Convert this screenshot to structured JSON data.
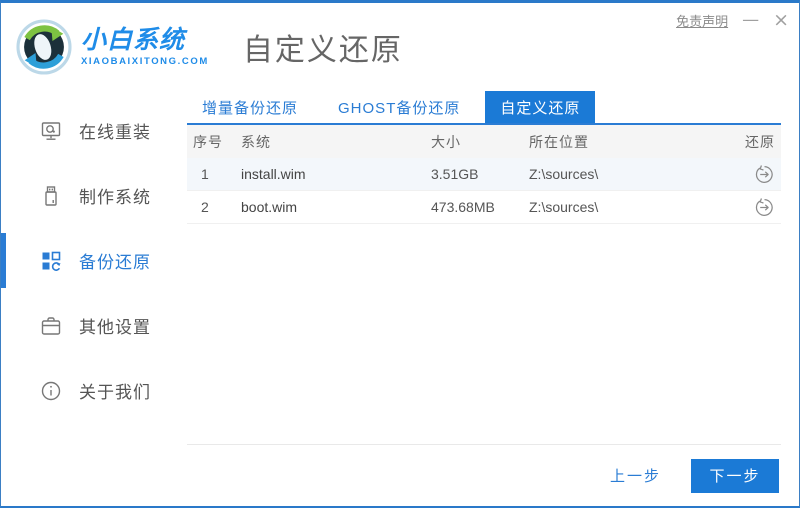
{
  "window": {
    "disclaimer_label": "免责声明",
    "minimize_glyph": "—",
    "close_glyph": "×"
  },
  "brand": {
    "name": "小白系统",
    "domain": "XIAOBAIXITONG.COM",
    "logo": "sync-arrows-logo"
  },
  "header": {
    "title": "自定义还原"
  },
  "sidebar": {
    "items": [
      {
        "label": "在线重装",
        "icon": "monitor-reinstall-icon",
        "active": false
      },
      {
        "label": "制作系统",
        "icon": "usb-drive-icon",
        "active": false
      },
      {
        "label": "备份还原",
        "icon": "backup-grid-icon",
        "active": true
      },
      {
        "label": "其他设置",
        "icon": "toolbox-icon",
        "active": false
      },
      {
        "label": "关于我们",
        "icon": "info-circle-icon",
        "active": false
      }
    ]
  },
  "tabs": [
    {
      "label": "增量备份还原",
      "active": false
    },
    {
      "label": "GHOST备份还原",
      "active": false
    },
    {
      "label": "自定义还原",
      "active": true
    }
  ],
  "table": {
    "headers": [
      "序号",
      "系统",
      "大小",
      "所在位置",
      "还原"
    ],
    "rows": [
      {
        "index": "1",
        "system": "install.wim",
        "size": "3.51GB",
        "location": "Z:\\sources\\",
        "action_icon": "restore-history-icon"
      },
      {
        "index": "2",
        "system": "boot.wim",
        "size": "473.68MB",
        "location": "Z:\\sources\\",
        "action_icon": "restore-history-icon"
      }
    ]
  },
  "footer": {
    "prev_label": "上一步",
    "next_label": "下一步"
  },
  "colors": {
    "accent": "#2a7cd4",
    "tab_active": "#1b7ad6",
    "brand": "#1f8ce8",
    "border": "#2a79c9",
    "border_side": "#3b7fc4",
    "row_alt": "#f3f7fb"
  }
}
